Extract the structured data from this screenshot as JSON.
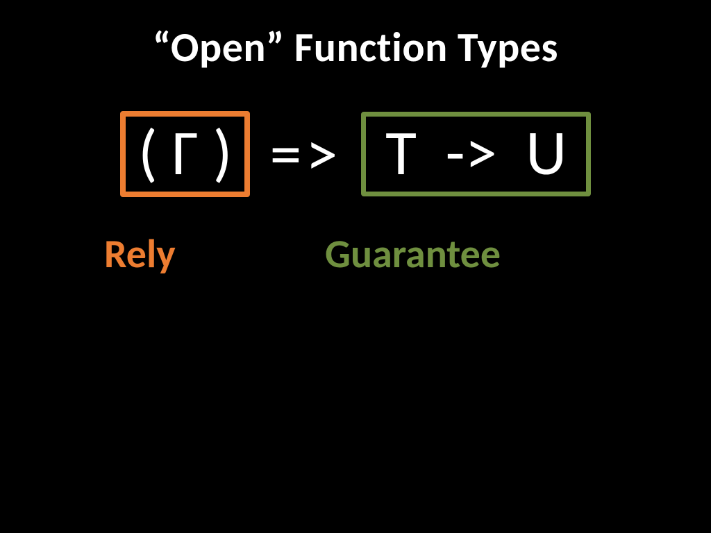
{
  "title": "“Open” Function Types",
  "formula": {
    "rely_box": "( Γ )",
    "arrow1": "=>",
    "guarantee_box": "T  ->  U"
  },
  "labels": {
    "rely": "Rely",
    "guarantee": "Guarantee"
  },
  "colors": {
    "rely": "#ed7d31",
    "guarantee": "#6f8f3f",
    "background": "#000000",
    "text": "#ffffff"
  }
}
